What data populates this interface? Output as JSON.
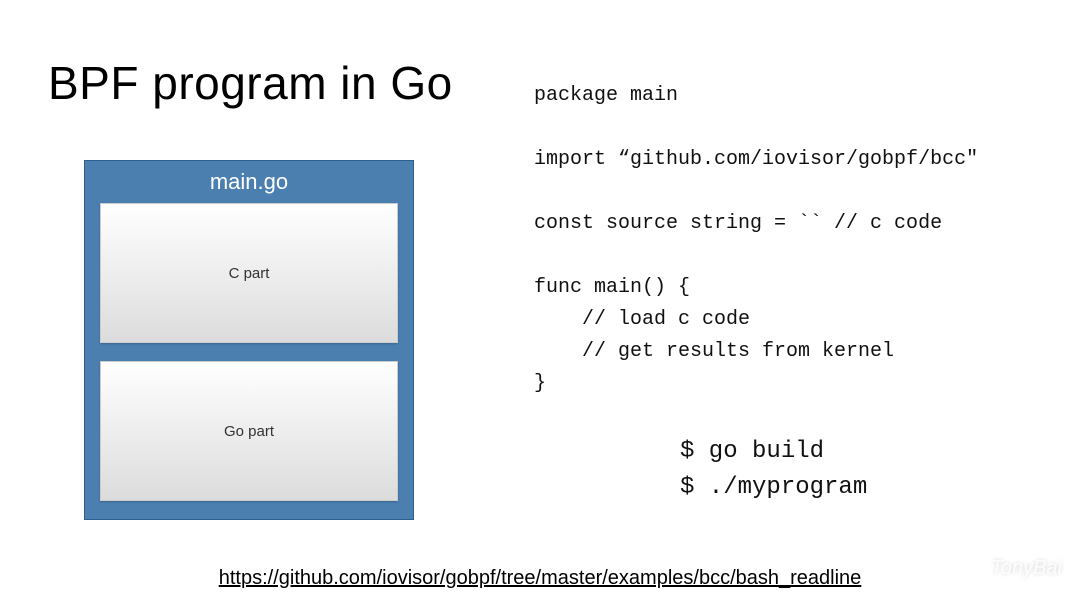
{
  "title": "BPF program in Go",
  "diagram": {
    "filename": "main.go",
    "c_part": "C part",
    "go_part": "Go part"
  },
  "code": {
    "l1": "package main",
    "l2": "",
    "l3": "import “github.com/iovisor/gobpf/bcc\"",
    "l4": "",
    "l5": "const source string = `` // c code",
    "l6": "",
    "l7": "func main() {",
    "l8": "    // load c code",
    "l9": "    // get results from kernel",
    "l10": "}"
  },
  "cmds": {
    "l1": "$ go build",
    "l2": "$ ./myprogram"
  },
  "link": "https://github.com/iovisor/gobpf/tree/master/examples/bcc/bash_readline",
  "watermark": "TonyBai"
}
